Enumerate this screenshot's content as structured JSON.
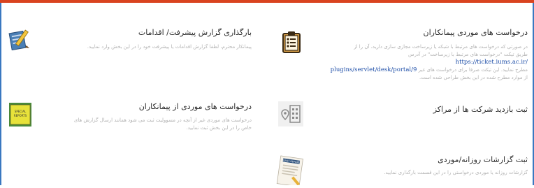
{
  "cards": {
    "contractor_requests": {
      "title": "درخواست های موردی پیمانکاران",
      "desc_line1": "در صورتی که درخواست های مرتبط با شبکه یا زیرساخت مجازی سازی دارید، آن را از",
      "desc_line2_pre": "طریق تیکت \"درخواست های مرتبط با زیرساخت\" در آدرس",
      "link_part1": "https://ticket.iums.ac.ir/",
      "link_part2": "plugins/servlet/desk/portal/9",
      "desc_line3_post": "مطرح نمایید. این تیکت صرفا برای درخواست های غیر",
      "desc_line4": "از موارد مطرح شده در این بخش طراحی شده است.",
      "icon": "clipboard-checklist-icon"
    },
    "progress_report": {
      "title": "بارگذاری گزارش پیشرفت/ اقدامات",
      "desc": "پیمانکار محترم، لطفا گزارش اقدامات یا پیشرفت خود را در این بخش وارد نمایید.",
      "icon": "pencil-report-icon"
    },
    "center_visit": {
      "title": "ثبت بازدید شرکت ها از مراکز",
      "icon": "building-location-icon"
    },
    "contractor_requests_2": {
      "title": "درخواست های موردی از پیمانکاران",
      "desc_line1": "درخواست های موردی غیر از آنچه در مسوولیت ثبت می شود همانند ارسال گزارش های",
      "desc_line2": "خاص را در این بخش ثبت نمایید.",
      "icon": "special-reports-icon",
      "icon_text": "SPECIAL REPORTS"
    },
    "daily_reports": {
      "title": "ثبت گزارشات روزانه/موردی",
      "desc": "گزارشات روزانه یا موردی درخواستی را در این قسمت بارگذاری نمایید.",
      "icon": "daily-report-paper-icon",
      "icon_text": "DAILY REPORT"
    }
  },
  "colors": {
    "top_bar": "#d9431f",
    "frame": "#3a78c0",
    "link": "#1f4fa8"
  }
}
